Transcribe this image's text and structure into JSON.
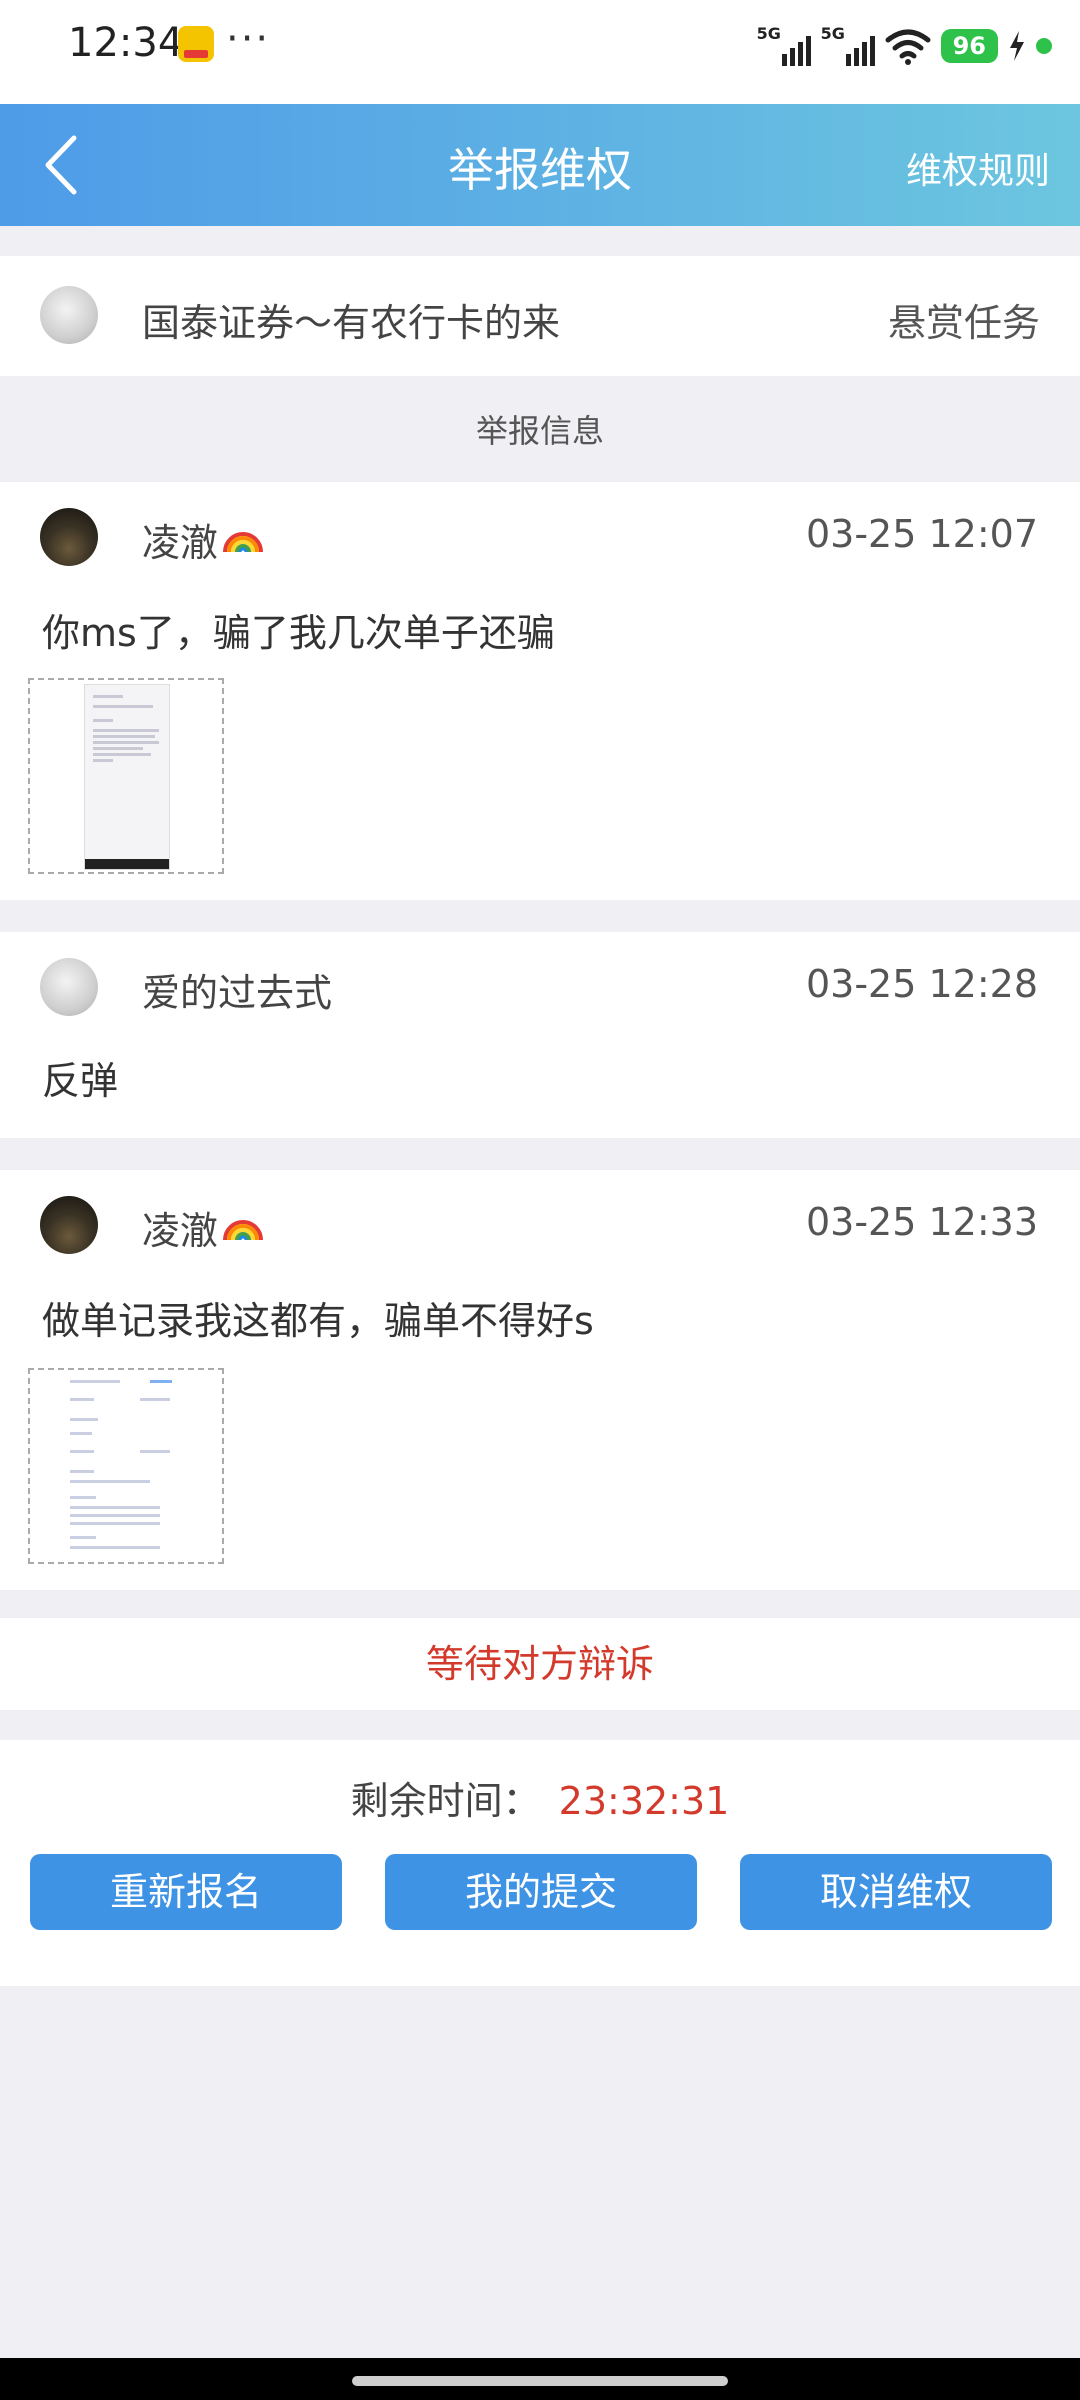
{
  "status_bar": {
    "time": "12:34",
    "more": "···",
    "signal1_label": "5G",
    "signal2_label": "5G",
    "battery": "96"
  },
  "header": {
    "title": "举报维权",
    "rules": "维权规则"
  },
  "task": {
    "name": "国泰证券～有农行卡的来",
    "type": "悬赏任务"
  },
  "section_label": "举报信息",
  "messages": [
    {
      "user": "凌澈",
      "time": "03-25 12:07",
      "text": "你ms了，骗了我几次单子还骗"
    },
    {
      "user": "爱的过去式",
      "time": "03-25 12:28",
      "text": "反弹"
    },
    {
      "user": "凌澈",
      "time": "03-25 12:33",
      "text": "做单记录我这都有，骗单不得好s"
    }
  ],
  "status_text": "等待对方辩诉",
  "remaining": {
    "label": "剩余时间：",
    "value": "23:32:31"
  },
  "buttons": {
    "reapply": "重新报名",
    "my_submission": "我的提交",
    "cancel": "取消维权"
  },
  "colors": {
    "header_start": "#4e9be8",
    "header_end": "#6cc6df",
    "button": "#3f93e5",
    "alert_red": "#d33a2c",
    "battery_green": "#2ec24b"
  }
}
